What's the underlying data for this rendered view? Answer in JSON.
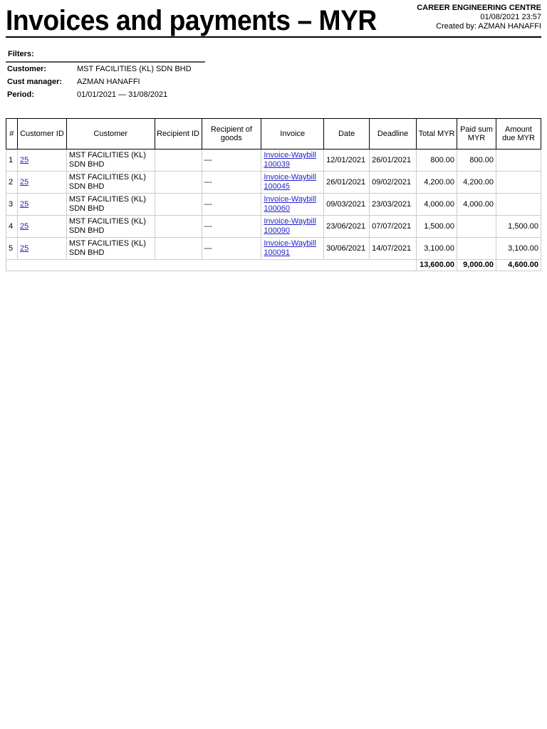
{
  "header": {
    "title": "Invoices and payments – MYR",
    "organization": "CAREER ENGINEERING CENTRE",
    "datetime": "01/08/2021 23:57",
    "created_by": "Created by: AZMAN HANAFFI"
  },
  "filters": {
    "heading": "Filters:",
    "items": [
      {
        "label": "Customer:",
        "value": "MST FACILITIES (KL) SDN BHD"
      },
      {
        "label": "Cust manager:",
        "value": "AZMAN HANAFFI"
      },
      {
        "label": "Period:",
        "value": "01/01/2021 — 31/08/2021"
      }
    ]
  },
  "table": {
    "columns": [
      "#",
      "Customer ID",
      "Customer",
      "Recipient ID",
      "Recipient of goods",
      "Invoice",
      "Date",
      "Deadline",
      "Total MYR",
      "Paid sum MYR",
      "Amount due MYR"
    ],
    "rows": [
      {
        "n": "1",
        "cust_id": "25",
        "customer": "MST FACILITIES (KL) SDN BHD",
        "recip_id": "",
        "recip_goods": "---",
        "invoice": "Invoice-Waybill 100039",
        "date": "12/01/2021",
        "deadline": "26/01/2021",
        "total": "800.00",
        "paid": "800.00",
        "due": ""
      },
      {
        "n": "2",
        "cust_id": "25",
        "customer": "MST FACILITIES (KL) SDN BHD",
        "recip_id": "",
        "recip_goods": "---",
        "invoice": "Invoice-Waybill 100045",
        "date": "26/01/2021",
        "deadline": "09/02/2021",
        "total": "4,200.00",
        "paid": "4,200.00",
        "due": ""
      },
      {
        "n": "3",
        "cust_id": "25",
        "customer": "MST FACILITIES (KL) SDN BHD",
        "recip_id": "",
        "recip_goods": "---",
        "invoice": "Invoice-Waybill 100060",
        "date": "09/03/2021",
        "deadline": "23/03/2021",
        "total": "4,000.00",
        "paid": "4,000.00",
        "due": ""
      },
      {
        "n": "4",
        "cust_id": "25",
        "customer": "MST FACILITIES (KL) SDN BHD",
        "recip_id": "",
        "recip_goods": "---",
        "invoice": "Invoice-Waybill 100090",
        "date": "23/06/2021",
        "deadline": "07/07/2021",
        "total": "1,500.00",
        "paid": "",
        "due": "1,500.00"
      },
      {
        "n": "5",
        "cust_id": "25",
        "customer": "MST FACILITIES (KL) SDN BHD",
        "recip_id": "",
        "recip_goods": "---",
        "invoice": "Invoice-Waybill 100091",
        "date": "30/06/2021",
        "deadline": "14/07/2021",
        "total": "3,100.00",
        "paid": "",
        "due": "3,100.00"
      }
    ],
    "totals": {
      "total": "13,600.00",
      "paid": "9,000.00",
      "due": "4,600.00"
    }
  }
}
